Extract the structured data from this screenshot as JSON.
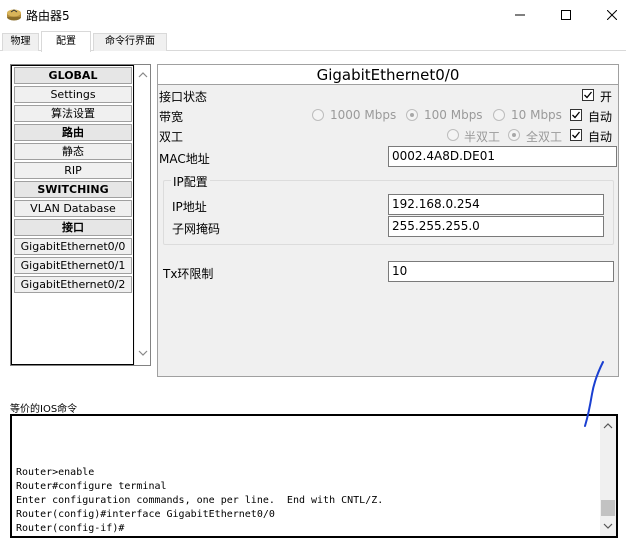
{
  "window": {
    "title": "路由器5",
    "icons": {
      "app": "router-icon",
      "minimize": "minimize-icon",
      "maximize": "maximize-icon",
      "close": "close-icon"
    }
  },
  "tabs": [
    {
      "label": "物理",
      "active": false
    },
    {
      "label": "配置",
      "active": true
    },
    {
      "label": "命令行界面",
      "active": false
    }
  ],
  "nav": {
    "items": [
      {
        "label": "GLOBAL",
        "header": true
      },
      {
        "label": "Settings",
        "header": false
      },
      {
        "label": "算法设置",
        "header": false
      },
      {
        "label": "路由",
        "header": true
      },
      {
        "label": "静态",
        "header": false
      },
      {
        "label": "RIP",
        "header": false
      },
      {
        "label": "SWITCHING",
        "header": true
      },
      {
        "label": "VLAN Database",
        "header": false
      },
      {
        "label": "接口",
        "header": true
      },
      {
        "label": "GigabitEthernet0/0",
        "header": false
      },
      {
        "label": "GigabitEthernet0/1",
        "header": false
      },
      {
        "label": "GigabitEthernet0/2",
        "header": false
      }
    ]
  },
  "config": {
    "title": "GigabitEthernet0/0",
    "port_status": {
      "label": "接口状态",
      "checkbox_label": "开",
      "checked": true
    },
    "bandwidth": {
      "label": "带宽",
      "options": [
        "1000 Mbps",
        "100 Mbps",
        "10 Mbps"
      ],
      "selected": "100 Mbps",
      "auto_label": "自动",
      "auto_checked": true
    },
    "duplex": {
      "label": "双工",
      "options": [
        "半双工",
        "全双工"
      ],
      "selected": "全双工",
      "auto_label": "自动",
      "auto_checked": true
    },
    "mac": {
      "label": "MAC地址",
      "value": "0002.4A8D.DE01"
    },
    "ip_group": {
      "legend": "IP配置"
    },
    "ip": {
      "label": "IP地址",
      "value": "192.168.0.254"
    },
    "mask": {
      "label": "子网掩码",
      "value": "255.255.255.0"
    },
    "tx_ring": {
      "label": "Tx环限制",
      "value": "10"
    }
  },
  "ios": {
    "label": "等价的IOS命令",
    "lines": [
      "Router>enable",
      "Router#configure terminal",
      "Enter configuration commands, one per line.  End with CNTL/Z.",
      "Router(config)#interface GigabitEthernet0/0",
      "Router(config-if)#"
    ]
  },
  "colors": {
    "accent_border": "#000000",
    "panel_bg": "#f0f0f0",
    "pen_stroke": "#1a3fd1"
  }
}
